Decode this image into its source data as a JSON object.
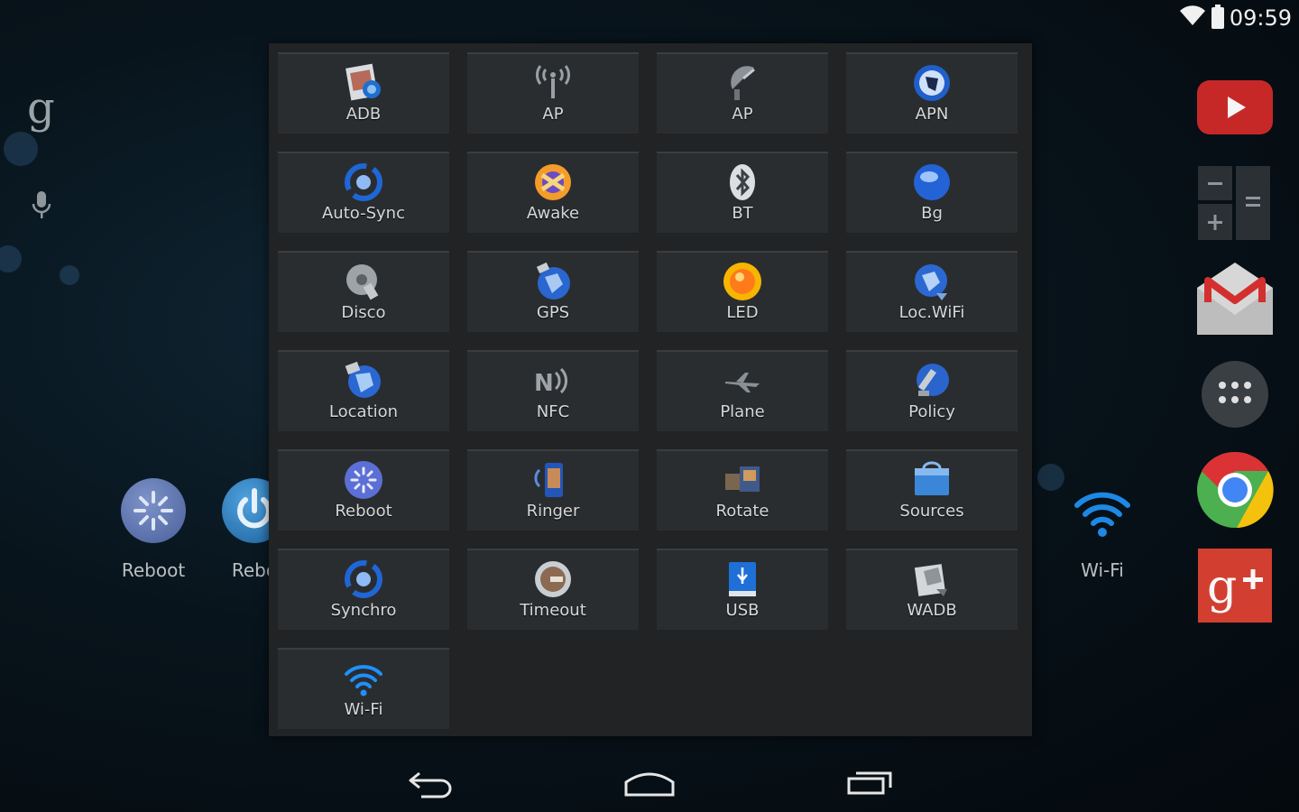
{
  "status_bar": {
    "time": "09:59",
    "wifi_icon": "wifi-icon",
    "battery_icon": "battery-icon"
  },
  "home": {
    "search_logo": "g",
    "shortcuts": [
      {
        "label": "Reboot",
        "icon": "reboot-icon"
      },
      {
        "label": "Rebo",
        "icon": "power-icon"
      },
      {
        "label": "Wi-Fi",
        "icon": "wifi-icon"
      }
    ],
    "dock": [
      {
        "name": "youtube",
        "icon": "youtube-icon",
        "color": "#c62828"
      },
      {
        "name": "calculator",
        "icon": "calculator-icon",
        "color": "#2b2f33"
      },
      {
        "name": "gmail",
        "icon": "gmail-icon",
        "color": "#e0e0e0"
      },
      {
        "name": "apps",
        "icon": "app-drawer-icon",
        "color": "#3a3f44"
      },
      {
        "name": "chrome",
        "icon": "chrome-icon",
        "color": "#4caf50"
      },
      {
        "name": "google-plus",
        "icon": "google-plus-icon",
        "color": "#d23f31"
      }
    ]
  },
  "panel": {
    "tiles": [
      {
        "label": "ADB",
        "icon": "adb-icon"
      },
      {
        "label": "AP",
        "icon": "antenna-icon"
      },
      {
        "label": "AP",
        "icon": "satellite-dish-icon"
      },
      {
        "label": "APN",
        "icon": "apn-globe-icon"
      },
      {
        "label": "Auto-Sync",
        "icon": "sync-icon"
      },
      {
        "label": "Awake",
        "icon": "awake-icon"
      },
      {
        "label": "BT",
        "icon": "bluetooth-icon"
      },
      {
        "label": "Bg",
        "icon": "globe-icon"
      },
      {
        "label": "Disco",
        "icon": "disco-icon"
      },
      {
        "label": "GPS",
        "icon": "gps-globe-icon"
      },
      {
        "label": "LED",
        "icon": "led-icon"
      },
      {
        "label": "Loc.WiFi",
        "icon": "location-wifi-icon"
      },
      {
        "label": "Location",
        "icon": "location-icon"
      },
      {
        "label": "NFC",
        "icon": "nfc-icon"
      },
      {
        "label": "Plane",
        "icon": "airplane-icon"
      },
      {
        "label": "Policy",
        "icon": "policy-icon"
      },
      {
        "label": "Reboot",
        "icon": "reboot-icon"
      },
      {
        "label": "Ringer",
        "icon": "ringer-icon"
      },
      {
        "label": "Rotate",
        "icon": "rotate-icon"
      },
      {
        "label": "Sources",
        "icon": "sources-icon"
      },
      {
        "label": "Synchro",
        "icon": "synchro-icon"
      },
      {
        "label": "Timeout",
        "icon": "timeout-icon"
      },
      {
        "label": "USB",
        "icon": "usb-icon"
      },
      {
        "label": "WADB",
        "icon": "wireless-adb-icon"
      },
      {
        "label": "Wi-Fi",
        "icon": "wifi-icon"
      }
    ]
  },
  "navbar": {
    "back": "back-icon",
    "home": "home-icon",
    "recents": "recents-icon"
  }
}
